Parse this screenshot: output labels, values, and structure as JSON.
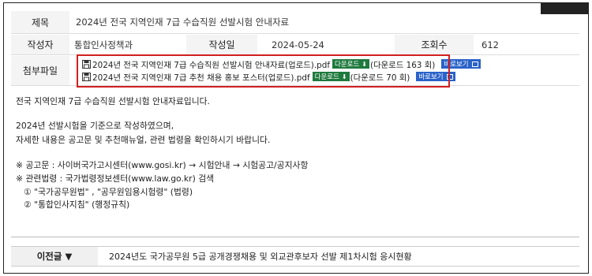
{
  "post": {
    "title_label": "제목",
    "title": "2024년 전국 지역인재 7급 수습직원 선발시험 안내자료",
    "author_label": "작성자",
    "author": "통합인사정책과",
    "date_label": "작성일",
    "date": "2024-05-24",
    "views_label": "조회수",
    "views": "612",
    "attachments_label": "첨부파일"
  },
  "attachments": [
    {
      "name": "2024년 전국 지역인재 7급 수습직원 선발시험 안내자료(업로드).pdf",
      "download_label": "다운로드",
      "count": "(다운로드 163 회)",
      "preview_label": "바로보기"
    },
    {
      "name": "2024년 전국 지역인재 7급 추천 채용 홍보 포스터(업로드).pdf",
      "download_label": "다운로드",
      "count": "(다운로드 70 회)",
      "preview_label": "바로보기"
    }
  ],
  "content": {
    "line1": "전국 지역인재 7급 수습직원 선발시험 안내자료입니다.",
    "line2": "2024년 선발시험을 기준으로 작성하였으며,",
    "line3": "자세한 내용은 공고문 및 추천매뉴얼, 관련 법령을 확인하시기 바랍니다.",
    "line4": "※ 공고문 : 사이버국가고시센터(www.gosi.kr) → 시험안내 → 시험공고/공지사항",
    "line5": "※ 관련법령 : 국가법령정보센터(www.law.go.kr) 검색",
    "line6": "① \"국가공무원법\" , \"공무원임용시험령\" (법령)",
    "line7": "② \"통합인사지침\" (행정규칙)"
  },
  "nav": {
    "prev_label": "이전글 ▼",
    "prev_title": "2024년도 국가공무원 5급 공개경쟁채용 및 외교관후보자 선발 제1차시험 응시현황"
  },
  "colors": {
    "download_bg": "#1f7a3e",
    "preview_bg": "#2a62c9",
    "highlight": "#d21f1f",
    "header_bg": "#f4f4f4"
  }
}
